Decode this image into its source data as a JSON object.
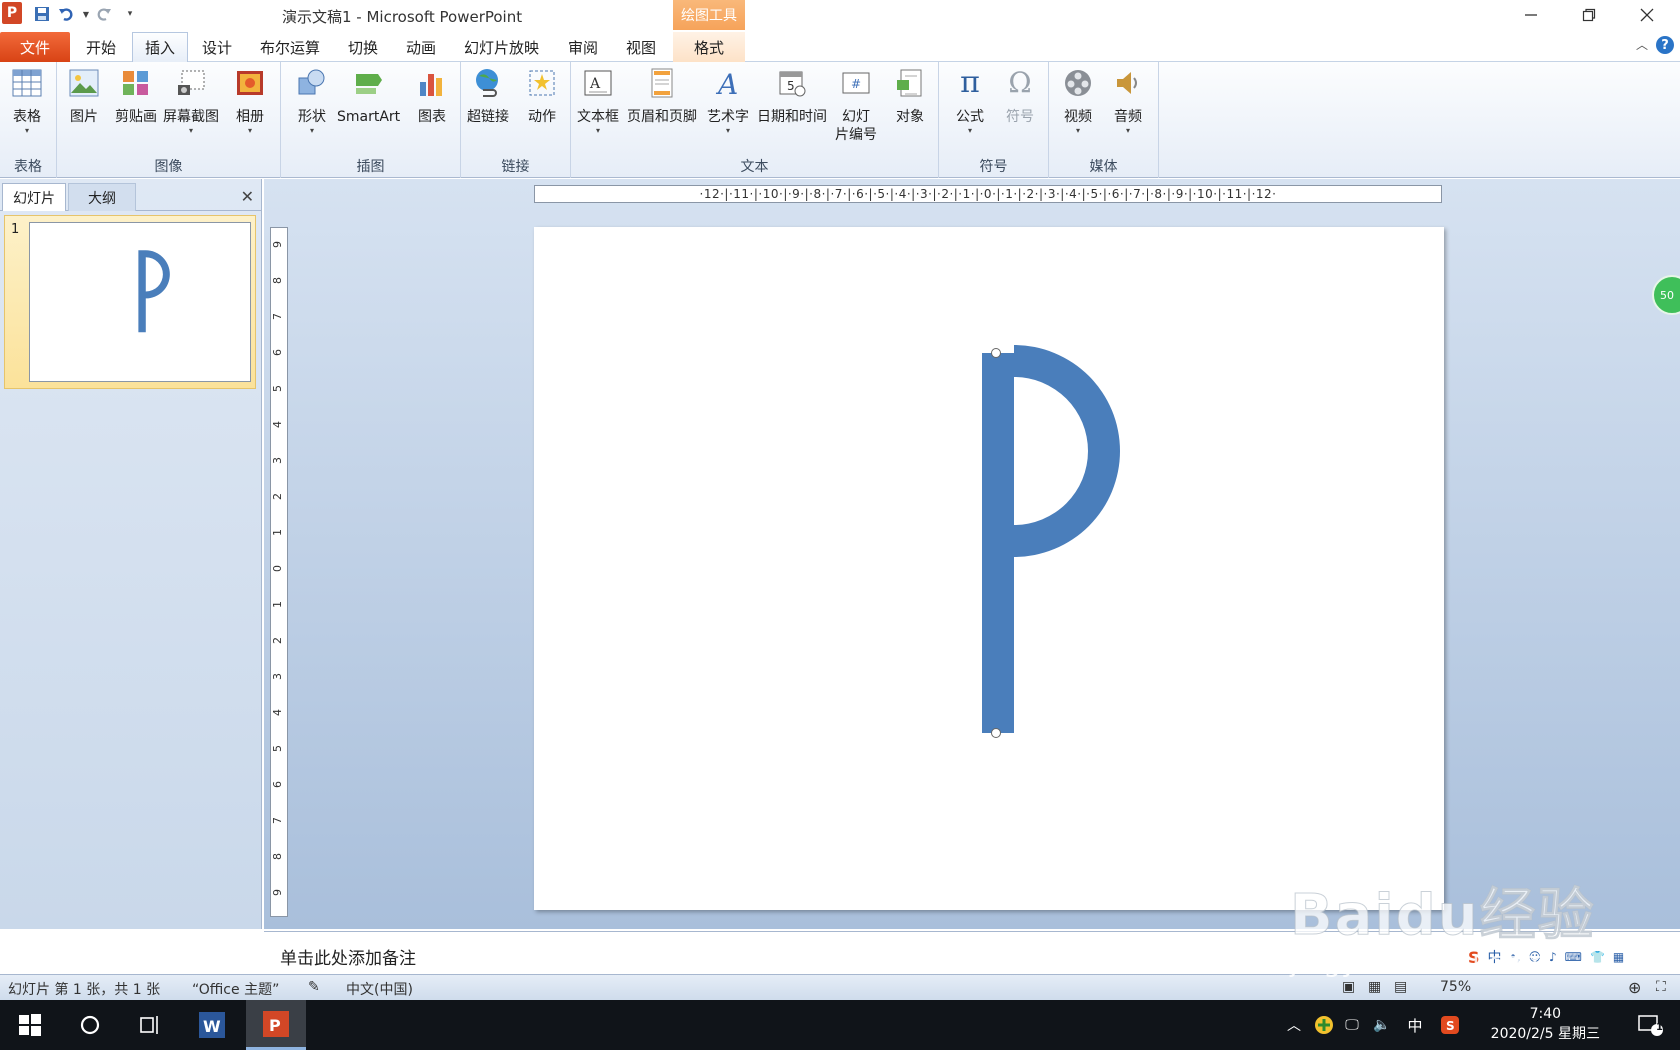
{
  "app": {
    "title": "演示文稿1 - Microsoft PowerPoint",
    "logo_letter": "P",
    "contextual_tab_header": "绘图工具"
  },
  "quick_access": [
    "save-icon",
    "undo-icon",
    "redo-icon",
    "customize-icon"
  ],
  "tabs": [
    {
      "label": "文件"
    },
    {
      "label": "开始"
    },
    {
      "label": "插入"
    },
    {
      "label": "设计"
    },
    {
      "label": "布尔运算"
    },
    {
      "label": "切换"
    },
    {
      "label": "动画"
    },
    {
      "label": "幻灯片放映"
    },
    {
      "label": "审阅"
    },
    {
      "label": "视图"
    },
    {
      "label": "格式"
    }
  ],
  "ribbon": {
    "groups": {
      "tables": {
        "label": "表格",
        "buttons": [
          {
            "label": "表格"
          }
        ]
      },
      "images": {
        "label": "图像",
        "buttons": [
          {
            "label": "图片"
          },
          {
            "label": "剪贴画"
          },
          {
            "label": "屏幕截图"
          },
          {
            "label": "相册"
          }
        ]
      },
      "illustrations": {
        "label": "插图",
        "buttons": [
          {
            "label": "形状"
          },
          {
            "label": "SmartArt"
          },
          {
            "label": "图表"
          }
        ]
      },
      "links": {
        "label": "链接",
        "buttons": [
          {
            "label": "超链接"
          },
          {
            "label": "动作"
          }
        ]
      },
      "text": {
        "label": "文本",
        "buttons": [
          {
            "label": "文本框"
          },
          {
            "label": "页眉和页脚"
          },
          {
            "label": "艺术字"
          },
          {
            "label": "日期和时间"
          },
          {
            "label": "幻灯",
            "label2": "片编号"
          },
          {
            "label": "对象"
          }
        ]
      },
      "symbols": {
        "label": "符号",
        "buttons": [
          {
            "label": "公式"
          },
          {
            "label": "符号"
          }
        ]
      },
      "media": {
        "label": "媒体",
        "buttons": [
          {
            "label": "视频"
          },
          {
            "label": "音频"
          }
        ]
      }
    }
  },
  "left_pane": {
    "tabs": [
      {
        "label": "幻灯片"
      },
      {
        "label": "大纲"
      }
    ],
    "slides": [
      {
        "number": "1"
      }
    ]
  },
  "ruler": {
    "horizontal": "·12·|·11·|·10·|·9·|·8·|·7·|·6·|·5·|·4·|·3·|·2·|·1·|·0·|·1·|·2·|·3·|·4·|·5·|·6·|·7·|·8·|·9·|·10·|·11·|·12·",
    "vertical": [
      "9",
      "8",
      "7",
      "6",
      "5",
      "4",
      "3",
      "2",
      "1",
      "0",
      "1",
      "2",
      "3",
      "4",
      "5",
      "6",
      "7",
      "8",
      "9"
    ]
  },
  "slide": {
    "shape_color": "#4a7ebb",
    "badge": "50"
  },
  "notes": {
    "placeholder": "单击此处添加备注"
  },
  "status": {
    "slide_info": "幻灯片 第 1 张，共 1 张",
    "theme": "“Office 主题”",
    "language": "中文(中国)",
    "zoom": "75%"
  },
  "taskbar": {
    "time": "7:40",
    "date": "2020/2/5 星期三",
    "ime": "中",
    "notifications": "1"
  },
  "watermark": {
    "line1": "Baidu经验",
    "line2": "jingyan.baidu.com"
  }
}
